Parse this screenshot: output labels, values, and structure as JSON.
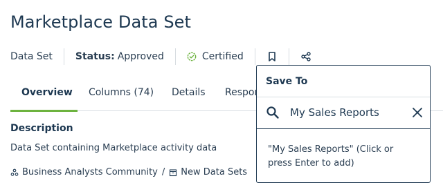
{
  "page": {
    "title": "Marketplace Data Set"
  },
  "meta": {
    "type": "Data Set",
    "status_label": "Status:",
    "status_value": "Approved",
    "certified": "Certified"
  },
  "tabs": [
    {
      "label": "Overview",
      "active": true
    },
    {
      "label": "Columns (74)"
    },
    {
      "label": "Details"
    },
    {
      "label": "Respor"
    }
  ],
  "description": {
    "label": "Description",
    "text": "Data Set containing Marketplace activity data"
  },
  "breadcrumb": {
    "community": "Business Analysts Community",
    "separator": "/",
    "folder": "New Data Sets"
  },
  "save_popup": {
    "title": "Save To",
    "search_value": "My Sales Reports",
    "suggestion": "\"My Sales Reports\" (Click or press Enter to add)"
  },
  "icons": {
    "certified": "check-circle-icon",
    "bookmark": "bookmark-icon",
    "share": "share-icon",
    "search": "search-icon",
    "clear": "close-icon",
    "community": "community-icon",
    "folder": "folder-icon"
  },
  "colors": {
    "accent": "#6db33f",
    "text": "#1d3851"
  }
}
